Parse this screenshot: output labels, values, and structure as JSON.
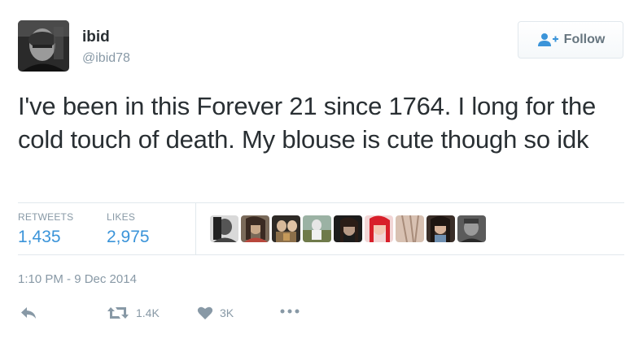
{
  "user": {
    "display_name": "ibid",
    "handle": "@ibid78",
    "avatar_icon": "avatar-photo"
  },
  "follow_button": {
    "label": "Follow",
    "icon": "add-user-icon"
  },
  "tweet": {
    "text": "I've been in this Forever 21 since 1764. I long for the cold touch of death. My blouse is cute though so idk",
    "timestamp": "1:10 PM - 9 Dec 2014"
  },
  "stats": {
    "retweets_label": "RETWEETS",
    "retweets_value": "1,435",
    "likes_label": "LIKES",
    "likes_value": "2,975"
  },
  "likers": [
    {
      "name": "liker-avatar-1"
    },
    {
      "name": "liker-avatar-2"
    },
    {
      "name": "liker-avatar-3"
    },
    {
      "name": "liker-avatar-4"
    },
    {
      "name": "liker-avatar-5"
    },
    {
      "name": "liker-avatar-6"
    },
    {
      "name": "liker-avatar-7"
    },
    {
      "name": "liker-avatar-8"
    },
    {
      "name": "liker-avatar-9"
    }
  ],
  "actions": {
    "reply_icon": "reply-icon",
    "retweet_icon": "retweet-icon",
    "retweet_count": "1.4K",
    "like_icon": "heart-icon",
    "like_count": "3K",
    "more_icon": "more-icon"
  },
  "colors": {
    "link_blue": "#3b94d9",
    "muted_gray": "#8899a6",
    "text_dark": "#292f33",
    "border": "#e1e8ed"
  }
}
